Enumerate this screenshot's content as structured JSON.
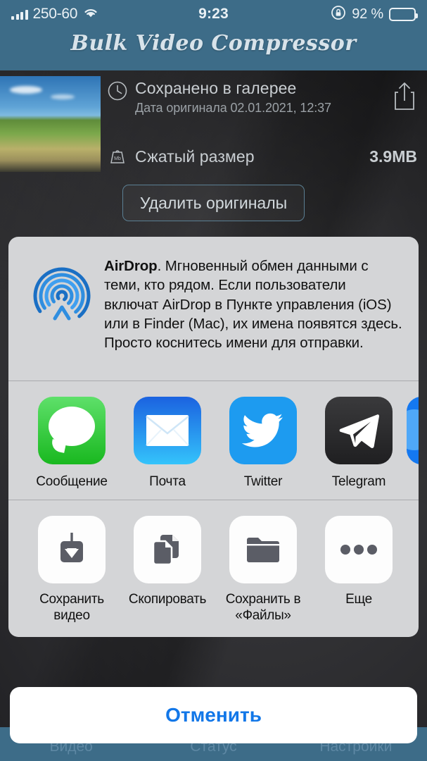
{
  "status_bar": {
    "carrier": "250-60",
    "signal_icon": "cellular-signal-icon",
    "wifi_icon": "wifi-icon",
    "time": "9:23",
    "rotation_lock_icon": "rotation-lock-icon",
    "battery_percent": "92 %",
    "battery_icon": "battery-icon"
  },
  "app": {
    "title": "Bulk Video Compressor"
  },
  "result_card": {
    "thumbnail_name": "video-thumbnail",
    "clock_icon": "clock-icon",
    "saved_title": "Сохранено в галерее",
    "original_date": "Дата оригинала 02.01.2021, 12:37",
    "share_icon": "share-icon",
    "weight_icon": "weight-mb-icon",
    "size_label": "Сжатый размер",
    "size_value": "3.9MB",
    "delete_originals_label": "Удалить оригиналы"
  },
  "share_sheet": {
    "airdrop": {
      "icon": "airdrop-icon",
      "title": "AirDrop",
      "description": ". Мгновенный обмен данными с теми, кто рядом. Если пользователи включат AirDrop в Пункте управления (iOS) или в Finder (Mac), их имена появятся здесь. Просто коснитесь имени для отправки."
    },
    "apps": [
      {
        "label": "Сообщение",
        "icon": "messages-icon",
        "color": "#19b81f"
      },
      {
        "label": "Почта",
        "icon": "mail-icon",
        "color": "#1b62e0"
      },
      {
        "label": "Twitter",
        "icon": "twitter-icon",
        "color": "#1d9bf0"
      },
      {
        "label": "Telegram",
        "icon": "telegram-icon",
        "color": "#2c2c2e"
      }
    ],
    "actions": [
      {
        "label": "Сохранить видео",
        "icon": "save-video-icon"
      },
      {
        "label": "Скопировать",
        "icon": "copy-icon"
      },
      {
        "label": "Сохранить в «Файлы»",
        "icon": "folder-icon"
      },
      {
        "label": "Еще",
        "icon": "more-ellipsis-icon"
      }
    ],
    "cancel_label": "Отменить"
  },
  "tab_bar": {
    "tabs": [
      {
        "label": "Видео"
      },
      {
        "label": "Статус"
      },
      {
        "label": "Настройки"
      }
    ]
  },
  "colors": {
    "brand_blue": "#3d6c88",
    "accent_blue": "#1277e8",
    "sheet_gray": "#d4d5d7"
  }
}
